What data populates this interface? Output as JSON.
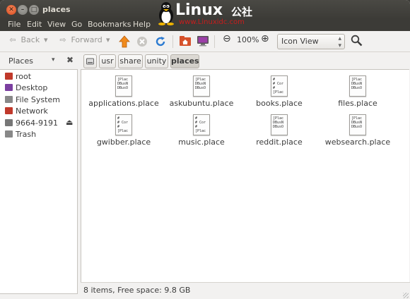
{
  "window": {
    "title": "places"
  },
  "menu": [
    "File",
    "Edit",
    "View",
    "Go",
    "Bookmarks",
    "Help"
  ],
  "watermark": {
    "brand": "Linux",
    "brand_cn": "公社",
    "url": "www.Linuxidc.com"
  },
  "toolbar": {
    "back_label": "Back",
    "forward_label": "Forward",
    "zoom_level": "100%",
    "view_mode": "Icon View"
  },
  "sidebar": {
    "header": "Places",
    "items": [
      {
        "label": "root",
        "icon": "home-folder-icon",
        "color": "#c0392b"
      },
      {
        "label": "Desktop",
        "icon": "desktop-icon",
        "color": "#7b3fa0"
      },
      {
        "label": "File System",
        "icon": "drive-icon",
        "color": "#888888"
      },
      {
        "label": "Network",
        "icon": "network-icon",
        "color": "#c0392b"
      },
      {
        "label": "9664-9191",
        "icon": "usb-drive-icon",
        "color": "#777777"
      },
      {
        "label": "Trash",
        "icon": "trash-icon",
        "color": "#888888"
      }
    ]
  },
  "pathbar": [
    "usr",
    "share",
    "unity",
    "places"
  ],
  "files": [
    {
      "name": "applications.place",
      "preview": "[Plac\nDBusN\nDBusO"
    },
    {
      "name": "askubuntu.place",
      "preview": "[Plac\nDBusN\nDBusO"
    },
    {
      "name": "books.place",
      "preview": "#\n# Cor\n#\n[Plac"
    },
    {
      "name": "files.place",
      "preview": "[Plac\nDBusN\nDBusO"
    },
    {
      "name": "gwibber.place",
      "preview": "#\n# Cor\n#\n[Plac"
    },
    {
      "name": "music.place",
      "preview": "#\n# Cor\n#\n[Plac"
    },
    {
      "name": "reddit.place",
      "preview": "[Plac\nDBusN\nDBusO"
    },
    {
      "name": "websearch.place",
      "preview": "[Plac\nDBusN\nDBusO"
    }
  ],
  "status": {
    "text": "8 items, Free space: 9.8 GB"
  }
}
